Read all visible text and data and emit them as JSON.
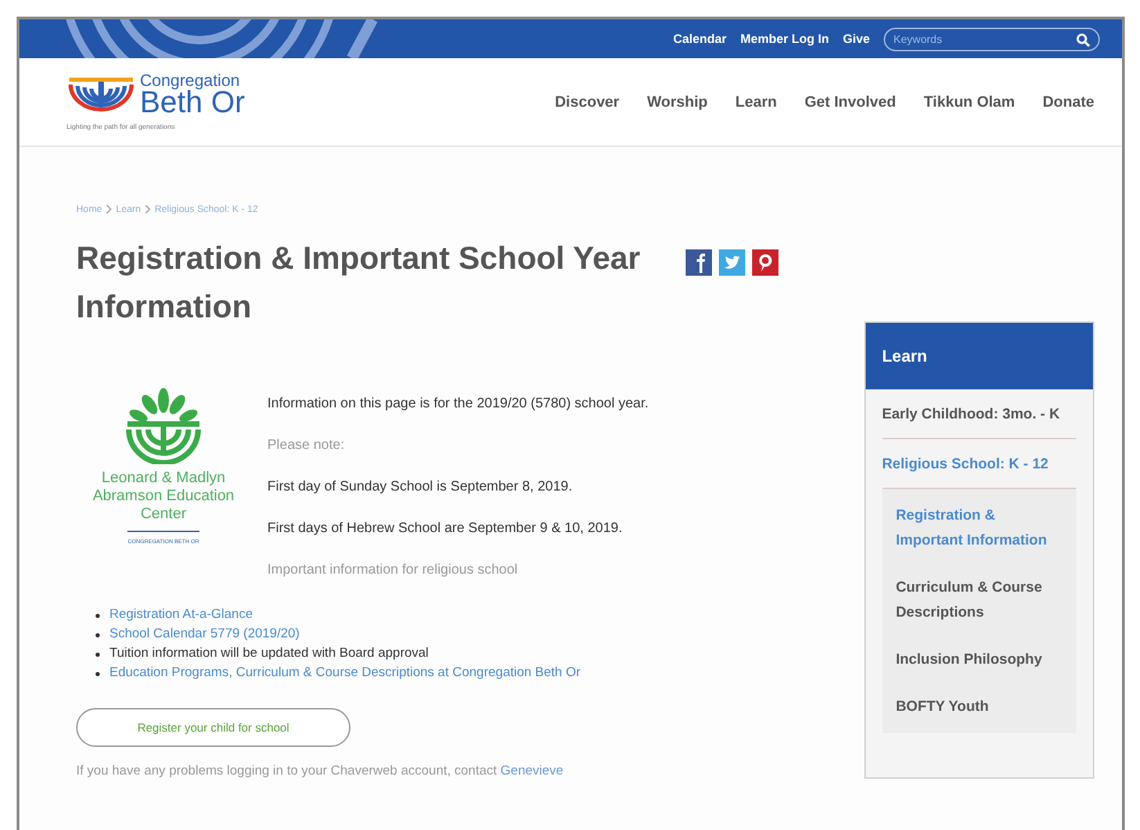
{
  "top_bar": {
    "links": [
      "Calendar",
      "Member Log In",
      "Give"
    ],
    "search": {
      "placeholder": "Keywords"
    }
  },
  "header": {
    "logo": {
      "name_small": "Congregation",
      "name_large": "Beth Or",
      "tagline": "Lighting the path for all generations"
    },
    "nav": [
      "Discover",
      "Worship",
      "Learn",
      "Get Involved",
      "Tikkun Olam",
      "Donate"
    ]
  },
  "breadcrumb": [
    "Home",
    "Learn",
    "Religious School: K - 12"
  ],
  "page_title": "Registration & Important School Year Information",
  "share": [
    {
      "kind": "facebook"
    },
    {
      "kind": "twitter"
    },
    {
      "kind": "pinterest"
    }
  ],
  "education_logo": {
    "name": "Leonard & Madlyn Abramson Education Center",
    "subtitle": "CONGREGATION BETH OR"
  },
  "paragraphs": [
    {
      "text": "Information on this page is for the 2019/20 (5780) school year.",
      "muted": false
    },
    {
      "text": "Please note:",
      "muted": true
    },
    {
      "text": "First day of Sunday School is September 8, 2019.",
      "muted": false
    },
    {
      "text": "First days of Hebrew School are September 9 & 10, 2019.",
      "muted": false
    },
    {
      "text": "Important information for religious school",
      "muted": true
    }
  ],
  "links_list": [
    {
      "text": "Registration At-a-Glance",
      "link": true
    },
    {
      "text": "School Calendar 5779 (2019/20)",
      "link": true
    },
    {
      "text": "Tuition information will be updated with Board approval",
      "link": false
    },
    {
      "text": "Education Programs, Curriculum & Course Descriptions at Congregation Beth Or",
      "link": true
    }
  ],
  "register_button": "Register your child for school",
  "contact": {
    "text": "If you have any problems logging in to your Chaverweb account, contact",
    "link": "Genevieve"
  },
  "sidebar": {
    "title": "Learn",
    "items": [
      {
        "label": "Early Childhood: 3mo. - K",
        "selected": false
      },
      {
        "label": "Religious School: K - 12",
        "selected": true,
        "children": [
          {
            "label": "Registration & Important Information",
            "selected": true
          },
          {
            "label": "Curriculum & Course Descriptions",
            "selected": false
          },
          {
            "label": "Inclusion Philosophy",
            "selected": false
          },
          {
            "label": "BOFTY Youth",
            "selected": false
          }
        ]
      }
    ]
  }
}
